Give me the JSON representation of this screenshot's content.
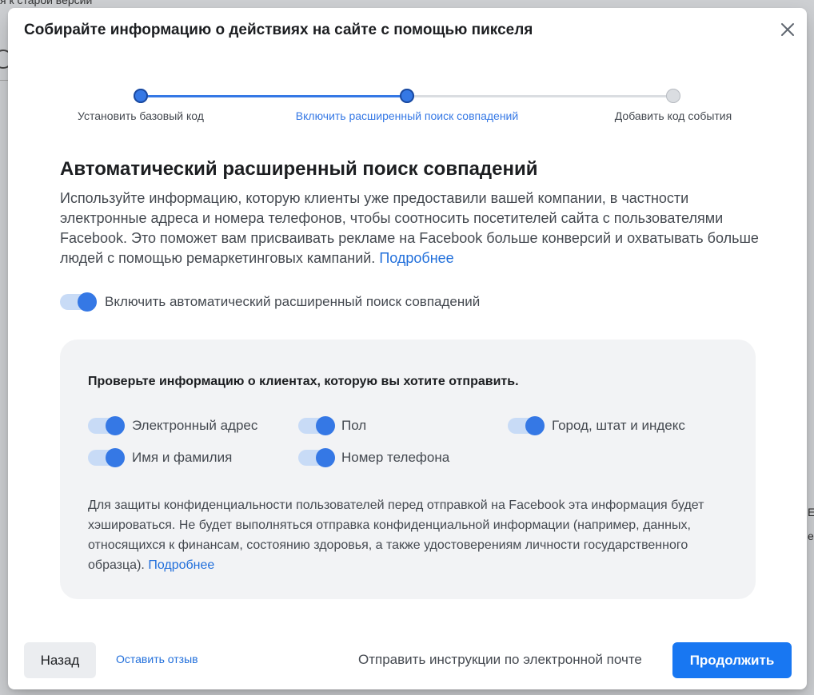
{
  "background": {
    "old_version_link": "я к старой версии",
    "right_text_1": "Е",
    "right_text_2": "е"
  },
  "modal": {
    "title": "Собирайте информацию о действиях на сайте с помощью пикселя",
    "close_icon": "close-icon"
  },
  "stepper": {
    "steps": [
      {
        "label": "Установить базовый код",
        "state": "done"
      },
      {
        "label": "Включить расширенный поиск совпадений",
        "state": "current"
      },
      {
        "label": "Добавить код события",
        "state": "todo"
      }
    ]
  },
  "section": {
    "title": "Автоматический расширенный поиск совпадений",
    "description": "Используйте информацию, которую клиенты уже предоставили вашей компании, в частности электронные адреса и номера телефонов, чтобы соотносить посетителей сайта с пользователями Facebook. Это поможет вам присваивать рекламе на Facebook больше конверсий и охватывать больше людей с помощью ремаркетинговых кампаний.",
    "learn_more": "Подробнее",
    "main_toggle": {
      "label": "Включить автоматический расширенный поиск совпадений",
      "on": true
    }
  },
  "info_box": {
    "title": "Проверьте информацию о клиентах, которую вы хотите отправить.",
    "fields": [
      {
        "label": "Электронный адрес",
        "on": true
      },
      {
        "label": "Пол",
        "on": true
      },
      {
        "label": "Город, штат и индекс",
        "on": true
      },
      {
        "label": "Имя и фамилия",
        "on": true
      },
      {
        "label": "Номер телефона",
        "on": true
      }
    ],
    "privacy_text": "Для защиты конфиденциальности пользователей перед отправкой на Facebook эта информация будет хэшироваться. Не будет выполняться отправка конфиденциальной информации (например, данных, относящихся к финансам, состоянию здоровья, а также удостоверениям личности государственного образца).",
    "learn_more": "Подробнее"
  },
  "footer": {
    "back_label": "Назад",
    "feedback_label": "Оставить отзыв",
    "email_label": "Отправить инструкции по электронной почте",
    "continue_label": "Продолжить"
  },
  "colors": {
    "accent": "#1877f2",
    "step_active": "#3578e5",
    "link": "#216fdb"
  }
}
